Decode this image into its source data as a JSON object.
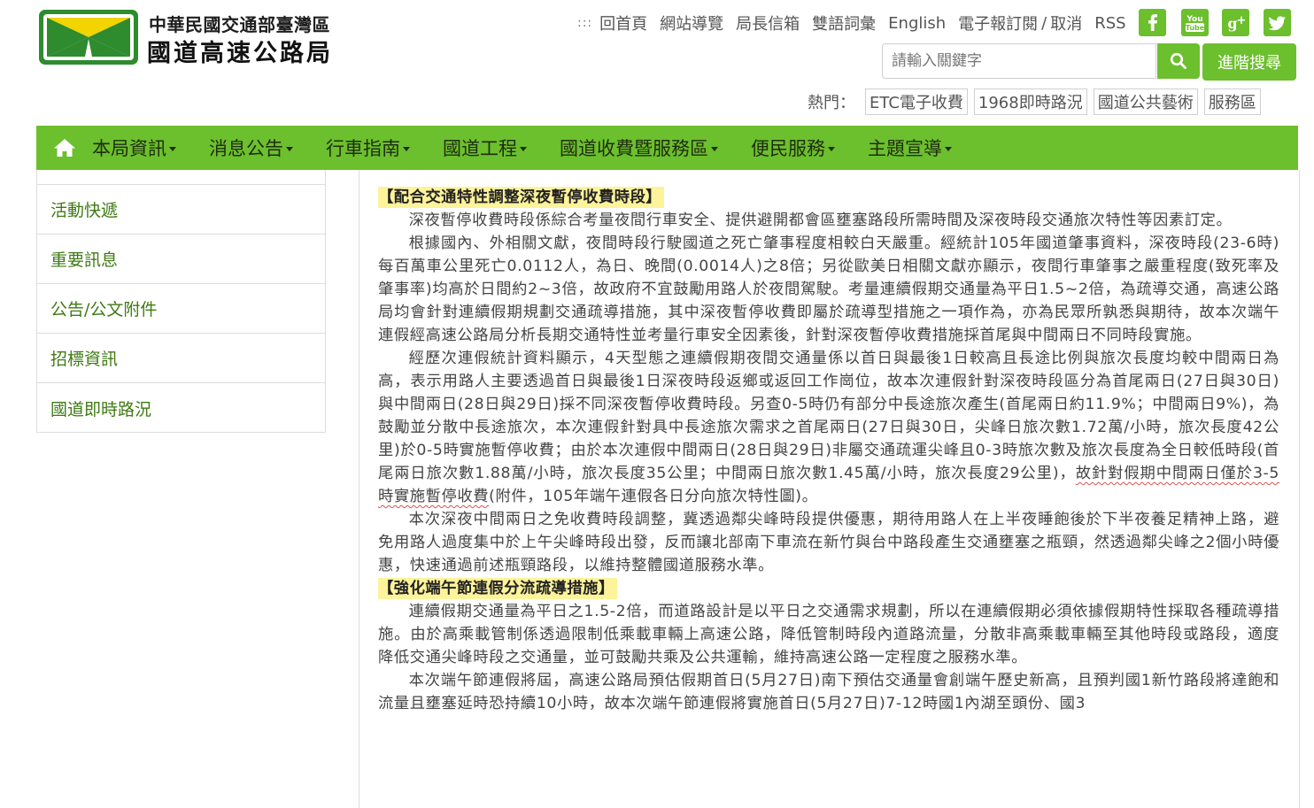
{
  "header": {
    "logo_line1": "中華民國交通部臺灣區",
    "logo_line2": "國道高速公路局",
    "top_links": [
      "回首頁",
      "網站導覽",
      "局長信箱",
      "雙語詞彙",
      "English"
    ],
    "subscribe": "電子報訂閱",
    "unsubscribe": "取消",
    "rss": "RSS",
    "social": [
      {
        "icon": "facebook-icon",
        "color": "#6cbf2d"
      },
      {
        "icon": "youtube-icon",
        "color": "#6cbf2d"
      },
      {
        "icon": "google-plus-icon",
        "color": "#6cbf2d"
      },
      {
        "icon": "twitter-icon",
        "color": "#6cbf2d"
      }
    ],
    "search_placeholder": "請輸入關鍵字",
    "advanced_search": "進階搜尋",
    "hot_label": "熱門：",
    "hot_tags": [
      "ETC電子收費",
      "1968即時路況",
      "國道公共藝術",
      "服務區"
    ]
  },
  "nav": {
    "accent_color": "#6cbf2d",
    "items": [
      "本局資訊",
      "消息公告",
      "行車指南",
      "國道工程",
      "國道收費暨服務區",
      "便民服務",
      "主題宣導"
    ]
  },
  "sidebar": {
    "items": [
      "活動快遞",
      "重要訊息",
      "公告/公文附件",
      "招標資訊",
      "國道即時路況"
    ]
  },
  "article": {
    "heading1": "【配合交通特性調整深夜暫停收費時段】",
    "p1": "深夜暫停收費時段係綜合考量夜間行車安全、提供避開都會區壅塞路段所需時間及深夜時段交通旅次特性等因素訂定。",
    "p2": "根據國內、外相關文獻，夜間時段行駛國道之死亡肇事程度相較白天嚴重。經統計105年國道肇事資料，深夜時段(23-6時)每百萬車公里死亡0.0112人，為日、晚間(0.0014人)之8倍；另從歐美日相關文獻亦顯示，夜間行車肇事之嚴重程度(致死率及肇事率)均高於日間約2~3倍，故政府不宜鼓勵用路人於夜間駕駛。考量連續假期交通量為平日1.5~2倍，為疏導交通，高速公路局均會針對連續假期規劃交通疏導措施，其中深夜暫停收費即屬於疏導型措施之一項作為，亦為民眾所孰悉與期待，故本次端午連假經高速公路局分析長期交通特性並考量行車安全因素後，針對深夜暫停收費措施採首尾與中間兩日不同時段實施。",
    "p3a": "經歷次連假統計資料顯示，4天型態之連續假期夜間交通量係以首日與最後1日較高且長途比例與旅次長度均較中間兩日為高，表示用路人主要透過首日與最後1日深夜時段返鄉或返回工作崗位，故本次連假針對深夜時段區分為首尾兩日(27日與30日)與中間兩日(28日與29日)採不同深夜暫停收費時段。另查0-5時仍有部分中長途旅次產生(首尾兩日約11.9%；中間兩日9%)，為鼓勵並分散中長途旅次，本次連假針對具中長途旅次需求之首尾兩日(27日與30日，尖峰日旅次數1.72萬/小時，旅次長度42公里)於0-5時實施暫停收費；由於本次連假中間兩日(28日與29日)非屬交通疏運尖峰且0-3時旅次數及旅次長度為全日較低時段(首尾兩日旅次數1.88萬/小時，旅次長度35公里；中間兩日旅次數1.45萬/小時，旅次長度29公里)，",
    "p3b": "故針對假期中間兩日僅於3-5時實施暫停收費",
    "p3c": "(附件，105年端午連假各日分向旅次特性圖)。",
    "p4": "本次深夜中間兩日之免收費時段調整，冀透過鄰尖峰時段提供優惠，期待用路人在上半夜睡飽後於下半夜養足精神上路，避免用路人過度集中於上午尖峰時段出發，反而讓北部南下車流在新竹與台中路段產生交通壅塞之瓶頸，然透過鄰尖峰之2個小時優惠，快速通過前述瓶頸路段，以維持整體國道服務水準。",
    "heading2": "【強化端午節連假分流疏導措施】",
    "p5": "連續假期交通量為平日之1.5-2倍，而道路設計是以平日之交通需求規劃，所以在連續假期必須依據假期特性採取各種疏導措施。由於高乘載管制係透過限制低乘載車輛上高速公路，降低管制時段內道路流量，分散非高乘載車輛至其他時段或路段，適度降低交通尖峰時段之交通量，並可鼓勵共乘及公共運輸，維持高速公路一定程度之服務水準。",
    "p6": "本次端午節連假將屆，高速公路局預估假期首日(5月27日)南下預估交通量會創端午歷史新高，且預判國1新竹路段將達飽和流量且壅塞延時恐持續10小時，故本次端午節連假將實施首日(5月27日)7-12時國1內湖至頭份、國3"
  }
}
